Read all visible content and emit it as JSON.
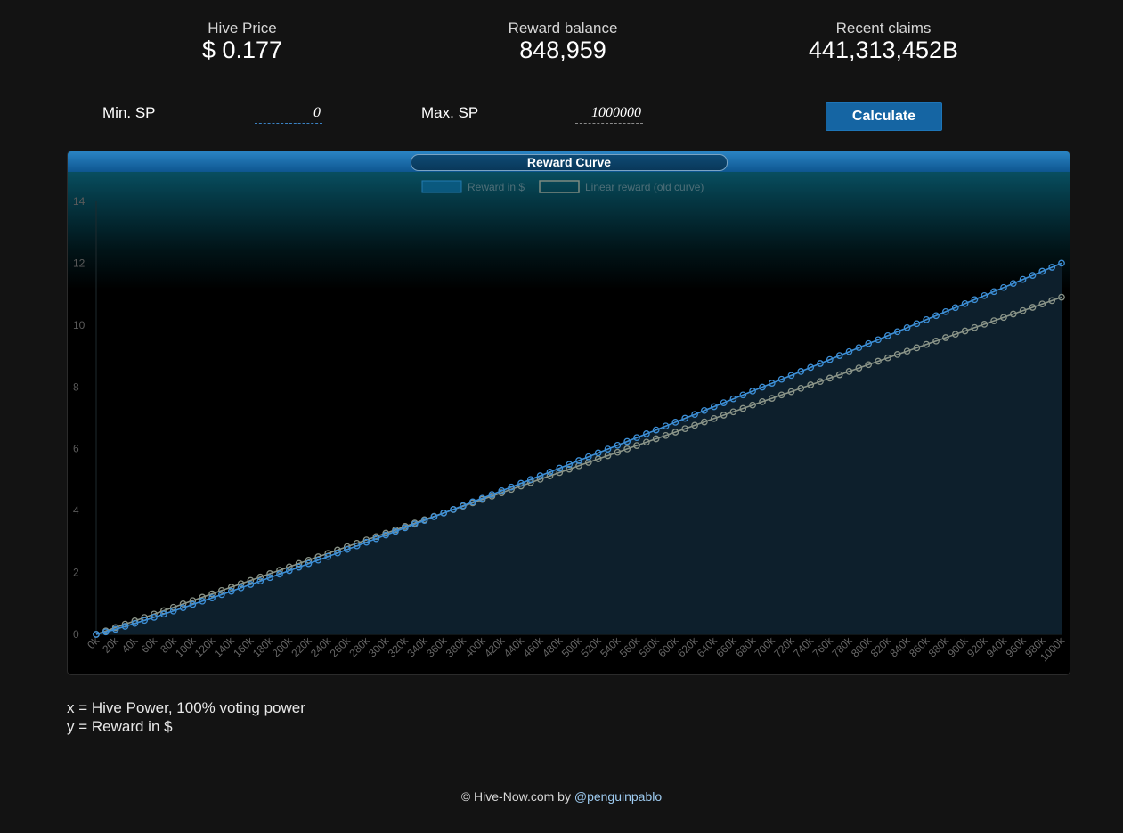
{
  "stats": {
    "price": {
      "label": "Hive Price",
      "value": "$ 0.177"
    },
    "balance": {
      "label": "Reward balance",
      "value": "848,959"
    },
    "claims": {
      "label": "Recent claims",
      "value": "441,313,452B"
    }
  },
  "form": {
    "min_label": "Min. SP",
    "min_value": "0",
    "max_label": "Max. SP",
    "max_value": "1000000",
    "calculate_label": "Calculate"
  },
  "chart_data": {
    "type": "line",
    "title": "Reward Curve",
    "xlabel": "",
    "ylabel": "",
    "x": [
      0,
      10000,
      20000,
      30000,
      40000,
      50000,
      60000,
      70000,
      80000,
      90000,
      100000,
      110000,
      120000,
      130000,
      140000,
      150000,
      160000,
      170000,
      180000,
      190000,
      200000,
      210000,
      220000,
      230000,
      240000,
      250000,
      260000,
      270000,
      280000,
      290000,
      300000,
      310000,
      320000,
      330000,
      340000,
      350000,
      360000,
      370000,
      380000,
      390000,
      400000,
      410000,
      420000,
      430000,
      440000,
      450000,
      460000,
      470000,
      480000,
      490000,
      500000,
      510000,
      520000,
      530000,
      540000,
      550000,
      560000,
      570000,
      580000,
      590000,
      600000,
      610000,
      620000,
      630000,
      640000,
      650000,
      660000,
      670000,
      680000,
      690000,
      700000,
      710000,
      720000,
      730000,
      740000,
      750000,
      760000,
      770000,
      780000,
      790000,
      800000,
      810000,
      820000,
      830000,
      840000,
      850000,
      860000,
      870000,
      880000,
      890000,
      900000,
      910000,
      920000,
      930000,
      940000,
      950000,
      960000,
      970000,
      980000,
      990000,
      1000000
    ],
    "x_tick_labels": [
      "0k",
      "20k",
      "40k",
      "60k",
      "80k",
      "100k",
      "120k",
      "140k",
      "160k",
      "180k",
      "200k",
      "220k",
      "240k",
      "260k",
      "280k",
      "300k",
      "320k",
      "340k",
      "360k",
      "380k",
      "400k",
      "420k",
      "440k",
      "460k",
      "480k",
      "500k",
      "520k",
      "540k",
      "560k",
      "580k",
      "600k",
      "620k",
      "640k",
      "660k",
      "680k",
      "700k",
      "720k",
      "740k",
      "760k",
      "780k",
      "800k",
      "820k",
      "840k",
      "860k",
      "880k",
      "900k",
      "920k",
      "940k",
      "960k",
      "980k",
      "1000k"
    ],
    "y_ticks": [
      0,
      2,
      4,
      6,
      8,
      10,
      12,
      14
    ],
    "ylim": [
      0,
      14
    ],
    "xlim": [
      0,
      1000000
    ],
    "grid": false,
    "legend_position": "top-center",
    "series": [
      {
        "name": "Reward in $",
        "color": "#3d8fd6",
        "fill": "#0d1f2c",
        "curve": {
          "end_value": 12.0,
          "exponent": 1.095
        }
      },
      {
        "name": "Linear reward (old curve)",
        "color": "#8a9488",
        "curve": {
          "end_value": 10.9,
          "exponent": 1.0
        }
      }
    ]
  },
  "notes": {
    "x": "x = Hive Power, 100% voting power",
    "y": "y = Reward in $"
  },
  "footer": {
    "text": "© Hive-Now.com by ",
    "author": "@penguinpablo"
  }
}
